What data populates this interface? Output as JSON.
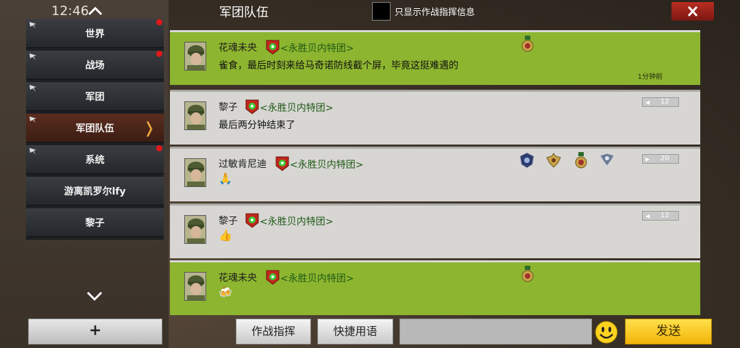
{
  "status": {
    "time": "12:46"
  },
  "header": {
    "title": "军团队伍",
    "filter_label": "只显示作战指挥信息"
  },
  "sidebar": {
    "items": [
      {
        "label": "世界",
        "pinned": true,
        "unread": true
      },
      {
        "label": "战场",
        "pinned": true,
        "unread": true
      },
      {
        "label": "军团",
        "pinned": true,
        "unread": false
      },
      {
        "label": "军团队伍",
        "pinned": true,
        "unread": false,
        "active": true
      },
      {
        "label": "系统",
        "pinned": true,
        "unread": true
      },
      {
        "label": "游离凯罗尔lfy",
        "pinned": false,
        "unread": false
      },
      {
        "label": "黎子",
        "pinned": false,
        "unread": false
      }
    ],
    "add_label": "+"
  },
  "messages": [
    {
      "user": "花魂未央",
      "corps": "<永胜贝内特团>",
      "text": "雀食，最后时刻来给马奇诺防线截个屏，毕竟这挺难遇的",
      "time_ago": "1分钟前",
      "style": "green",
      "medals": [
        "medal-icon"
      ]
    },
    {
      "user": "黎子",
      "corps": "<永胜贝内特团>",
      "text": "最后两分钟结束了",
      "level": "12",
      "style": "gray"
    },
    {
      "user": "过敏肯尼迪",
      "corps": "<永胜贝内特团>",
      "text": "🙏",
      "level": "20",
      "style": "gray",
      "medals": [
        "shield-rank-icon",
        "wing-rank-icon",
        "medal-icon",
        "eagle-rank-icon"
      ]
    },
    {
      "user": "黎子",
      "corps": "<永胜贝内特团>",
      "text": "👍",
      "level": "12",
      "style": "gray"
    },
    {
      "user": "花魂未央",
      "corps": "<永胜贝内特团>",
      "text": "🍻",
      "style": "green",
      "medals": [
        "medal-icon"
      ]
    }
  ],
  "bottom": {
    "command_label": "作战指挥",
    "quick_label": "快捷用语",
    "input_value": "",
    "send_label": "发送"
  },
  "colors": {
    "green_row": "#8db52f",
    "gray_row": "#d7d6d3",
    "send": "#f3b40a",
    "badge_red": "#e01818"
  }
}
